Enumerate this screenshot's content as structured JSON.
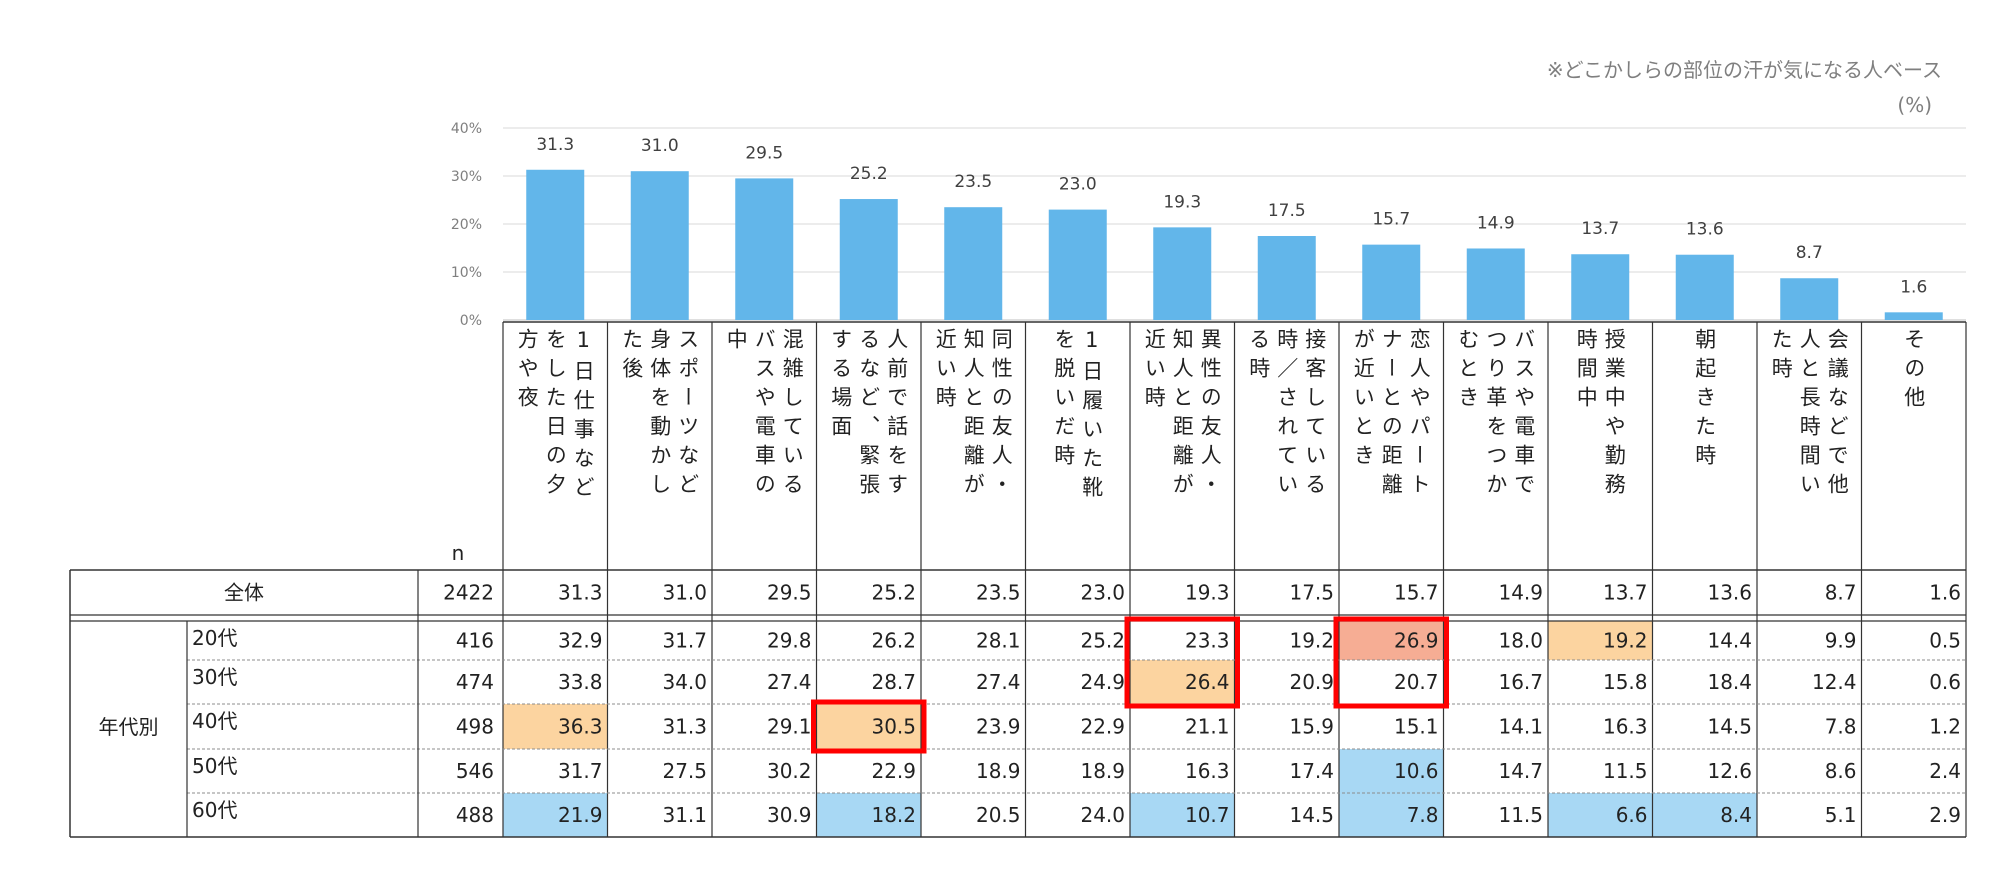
{
  "note": "※どこかしらの部位の汗が気になる人ベース",
  "unit": "(%)",
  "colors": {
    "bar": "#62b6ea",
    "grid": "#d9d9d9",
    "orange": "#fcd4a0",
    "salmon": "#f6ad94",
    "blue": "#a8d8f4",
    "red": "#ff0000"
  },
  "chart_data": {
    "type": "bar",
    "ylim": [
      0,
      40
    ],
    "yticks": [
      "0%",
      "10%",
      "20%",
      "30%",
      "40%"
    ],
    "categories": [
      "1日仕事などをした日の夕方や夜",
      "スポーツなど身体を動かした後",
      "混雑しているバスや電車の中",
      "人前で話をするなど、緊張する場面",
      "同性の友人・知人と距離が近い時",
      "1日履いた靴を脱いだ時",
      "異性の友人・知人と距離が近い時",
      "接客している時／されている時",
      "恋人やパートナーとの距離が近いとき",
      "バスや電車でつり革をつかむとき",
      "授業中や勤務時間中",
      "朝起きた時",
      "会議などで他人と長時間いた時",
      "その他"
    ],
    "columns": [
      [
        "1日仕事など",
        "をした日の夕",
        "方や夜"
      ],
      [
        "スポーツなど",
        "身体を動かし",
        "た後"
      ],
      [
        "混雑している",
        "バスや電車の",
        "中"
      ],
      [
        "人前で話をす",
        "るなど、緊張",
        "する場面"
      ],
      [
        "同性の友人・",
        "知人と距離が",
        "近い時"
      ],
      [
        "1日履いた靴",
        "を脱いだ時"
      ],
      [
        "異性の友人・",
        "知人と距離が",
        "近い時"
      ],
      [
        "接客している",
        "時／されてい",
        "る時"
      ],
      [
        "恋人やパート",
        "ナーとの距離",
        "が近いとき"
      ],
      [
        "バスや電車で",
        "つり革をつか",
        "むとき"
      ],
      [
        "授業中や勤務",
        "時間中"
      ],
      [
        "朝起きた時"
      ],
      [
        "会議などで他",
        "人と長時間い",
        "た時"
      ],
      [
        "その他"
      ]
    ],
    "values": [
      31.3,
      31.0,
      29.5,
      25.2,
      23.5,
      23.0,
      19.3,
      17.5,
      15.7,
      14.9,
      13.7,
      13.6,
      8.7,
      1.6
    ],
    "labels": [
      "31.3",
      "31.0",
      "29.5",
      "25.2",
      "23.5",
      "23.0",
      "19.3",
      "17.5",
      "15.7",
      "14.9",
      "13.7",
      "13.6",
      "8.7",
      "1.6"
    ]
  },
  "table": {
    "n_header": "n",
    "group_label": "年代別",
    "rows": [
      {
        "label": "全体",
        "n": "2422",
        "values": [
          "31.3",
          "31.0",
          "29.5",
          "25.2",
          "23.5",
          "23.0",
          "19.3",
          "17.5",
          "15.7",
          "14.9",
          "13.7",
          "13.6",
          "8.7",
          "1.6"
        ],
        "fills": {}
      },
      {
        "label": "20代",
        "n": "416",
        "values": [
          "32.9",
          "31.7",
          "29.8",
          "26.2",
          "28.1",
          "25.2",
          "23.3",
          "19.2",
          "26.9",
          "18.0",
          "19.2",
          "14.4",
          "9.9",
          "0.5"
        ],
        "fills": {
          "8": "salmon",
          "10": "orange"
        }
      },
      {
        "label": "30代",
        "n": "474",
        "values": [
          "33.8",
          "34.0",
          "27.4",
          "28.7",
          "27.4",
          "24.9",
          "26.4",
          "20.9",
          "20.7",
          "16.7",
          "15.8",
          "18.4",
          "12.4",
          "0.6"
        ],
        "fills": {
          "6": "orange"
        }
      },
      {
        "label": "40代",
        "n": "498",
        "values": [
          "36.3",
          "31.3",
          "29.1",
          "30.5",
          "23.9",
          "22.9",
          "21.1",
          "15.9",
          "15.1",
          "14.1",
          "16.3",
          "14.5",
          "7.8",
          "1.2"
        ],
        "fills": {
          "0": "orange",
          "3": "orange"
        }
      },
      {
        "label": "50代",
        "n": "546",
        "values": [
          "31.7",
          "27.5",
          "30.2",
          "22.9",
          "18.9",
          "18.9",
          "16.3",
          "17.4",
          "10.6",
          "14.7",
          "11.5",
          "12.6",
          "8.6",
          "2.4"
        ],
        "fills": {
          "8": "blue"
        }
      },
      {
        "label": "60代",
        "n": "488",
        "values": [
          "21.9",
          "31.1",
          "30.9",
          "18.2",
          "20.5",
          "24.0",
          "10.7",
          "14.5",
          "7.8",
          "11.5",
          "6.6",
          "8.4",
          "5.1",
          "2.9"
        ],
        "fills": {
          "0": "blue",
          "3": "blue",
          "6": "blue",
          "8": "blue",
          "10": "blue",
          "11": "blue"
        }
      }
    ],
    "highlights": [
      {
        "rows": [
          3,
          3
        ],
        "cols": [
          3,
          3
        ]
      },
      {
        "rows": [
          1,
          2
        ],
        "cols": [
          6,
          6
        ]
      },
      {
        "rows": [
          1,
          2
        ],
        "cols": [
          8,
          8
        ]
      }
    ]
  }
}
